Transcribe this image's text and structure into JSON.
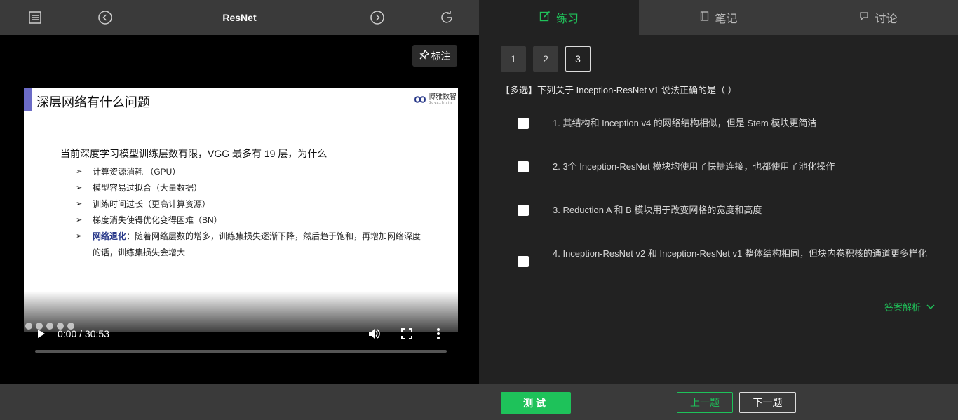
{
  "header": {
    "title": "ResNet"
  },
  "player": {
    "mark_label": "标注",
    "time": "0:00 / 30:53"
  },
  "slide": {
    "title": "深层网络有什么问题",
    "logo_text": "博雅数智",
    "logo_sub": "Boyazhixin",
    "heading": "当前深度学习模型训练层数有限，VGG 最多有 19 层，为什么",
    "bullets": [
      "计算资源消耗 （GPU）",
      "模型容易过拟合（大量数据）",
      "训练时间过长（更高计算资源）",
      "梯度消失使得优化变得困难（BN）"
    ],
    "last_bullet_em": "网络退化",
    "last_bullet_rest": "：随着网络层数的增多，训练集损失逐渐下降，然后趋于饱和，再增加网络深度的话，训练集损失会增大"
  },
  "tabs": [
    {
      "label": "练习",
      "icon": "edit-icon"
    },
    {
      "label": "笔记",
      "icon": "notebook-icon"
    },
    {
      "label": "讨论",
      "icon": "chat-icon"
    }
  ],
  "question_numbers": [
    "1",
    "2",
    "3"
  ],
  "question": "【多选】下列关于 Inception-ResNet v1 说法正确的是（ ）",
  "options": [
    "1. 其结构和 Inception v4 的网络结构相似，但是 Stem 模块更简洁",
    "2. 3个 Inception-ResNet 模块均使用了快捷连接，也都使用了池化操作",
    "3. Reduction A 和 B 模块用于改变网格的宽度和高度",
    "4. Inception-ResNet v2 和 Inception-ResNet v1 整体结构相同，但块内卷积核的通道更多样化"
  ],
  "analysis_label": "答案解析",
  "buttons": {
    "test": "测试",
    "prev": "上一题",
    "next": "下一题"
  },
  "colors": {
    "accent": "#1ec25a",
    "panel": "#3a3a3a",
    "background": "#222222"
  }
}
